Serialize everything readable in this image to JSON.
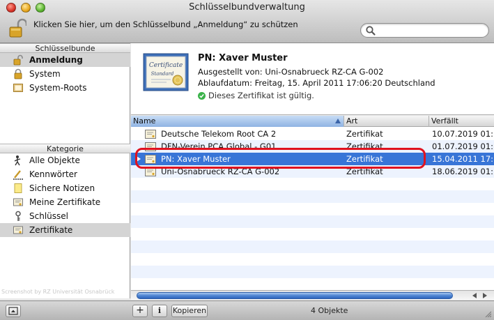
{
  "window": {
    "title": "Schlüsselbundverwaltung"
  },
  "toolbar": {
    "lock_message": "Klicken Sie hier, um den Schlüsselbund „Anmeldung“ zu schützen",
    "search_placeholder": ""
  },
  "sidebar": {
    "keychains_header": "Schlüsselbunde",
    "keychains": [
      {
        "label": "Anmeldung",
        "icon": "lock-open-icon",
        "selected": true
      },
      {
        "label": "System",
        "icon": "lock-icon",
        "selected": false
      },
      {
        "label": "System-Roots",
        "icon": "folder-icon",
        "selected": false
      }
    ],
    "category_header": "Kategorie",
    "categories": [
      {
        "label": "Alle Objekte",
        "icon": "people-icon"
      },
      {
        "label": "Kennwörter",
        "icon": "password-icon"
      },
      {
        "label": "Sichere Notizen",
        "icon": "note-icon"
      },
      {
        "label": "Meine Zertifikate",
        "icon": "my-certificate-icon"
      },
      {
        "label": "Schlüssel",
        "icon": "key-icon"
      },
      {
        "label": "Zertifikate",
        "icon": "certificate-icon",
        "selected": true
      }
    ],
    "watermark": "Screenshot by RZ Universität Osnabrück"
  },
  "details": {
    "title": "PN: Xaver Muster",
    "issued_by": "Ausgestellt von: Uni-Osnabrueck RZ-CA G-002",
    "expiry": "Ablaufdatum: Freitag, 15. April 2011 17:06:20 Deutschland",
    "valid_text": "Dieses Zertifikat ist gültig.",
    "cert_lines": [
      "Certificate",
      "Standard"
    ]
  },
  "table": {
    "columns": [
      "Name",
      "Art",
      "Verfällt"
    ],
    "rows": [
      {
        "name": "Deutsche Telekom Root CA 2",
        "kind": "Zertifikat",
        "expires": "10.07.2019 01:..."
      },
      {
        "name": "DFN-Verein PCA Global - G01",
        "kind": "Zertifikat",
        "expires": "01.07.2019 01:..."
      },
      {
        "name": "PN: Xaver Muster",
        "kind": "Zertifikat",
        "expires": "15.04.2011 17:...",
        "selected": true
      },
      {
        "name": "Uni-Osnabrueck RZ-CA G-002",
        "kind": "Zertifikat",
        "expires": "18.06.2019 01:..."
      }
    ]
  },
  "bottombar": {
    "add_label": "+",
    "info_label": "i",
    "copy_label": "Kopieren",
    "count": "4 Objekte"
  },
  "colors": {
    "selection": "#3875d7",
    "alt_row": "#edf3fe",
    "highlight_ring": "#e0121f",
    "valid_check": "#3bb34a"
  }
}
